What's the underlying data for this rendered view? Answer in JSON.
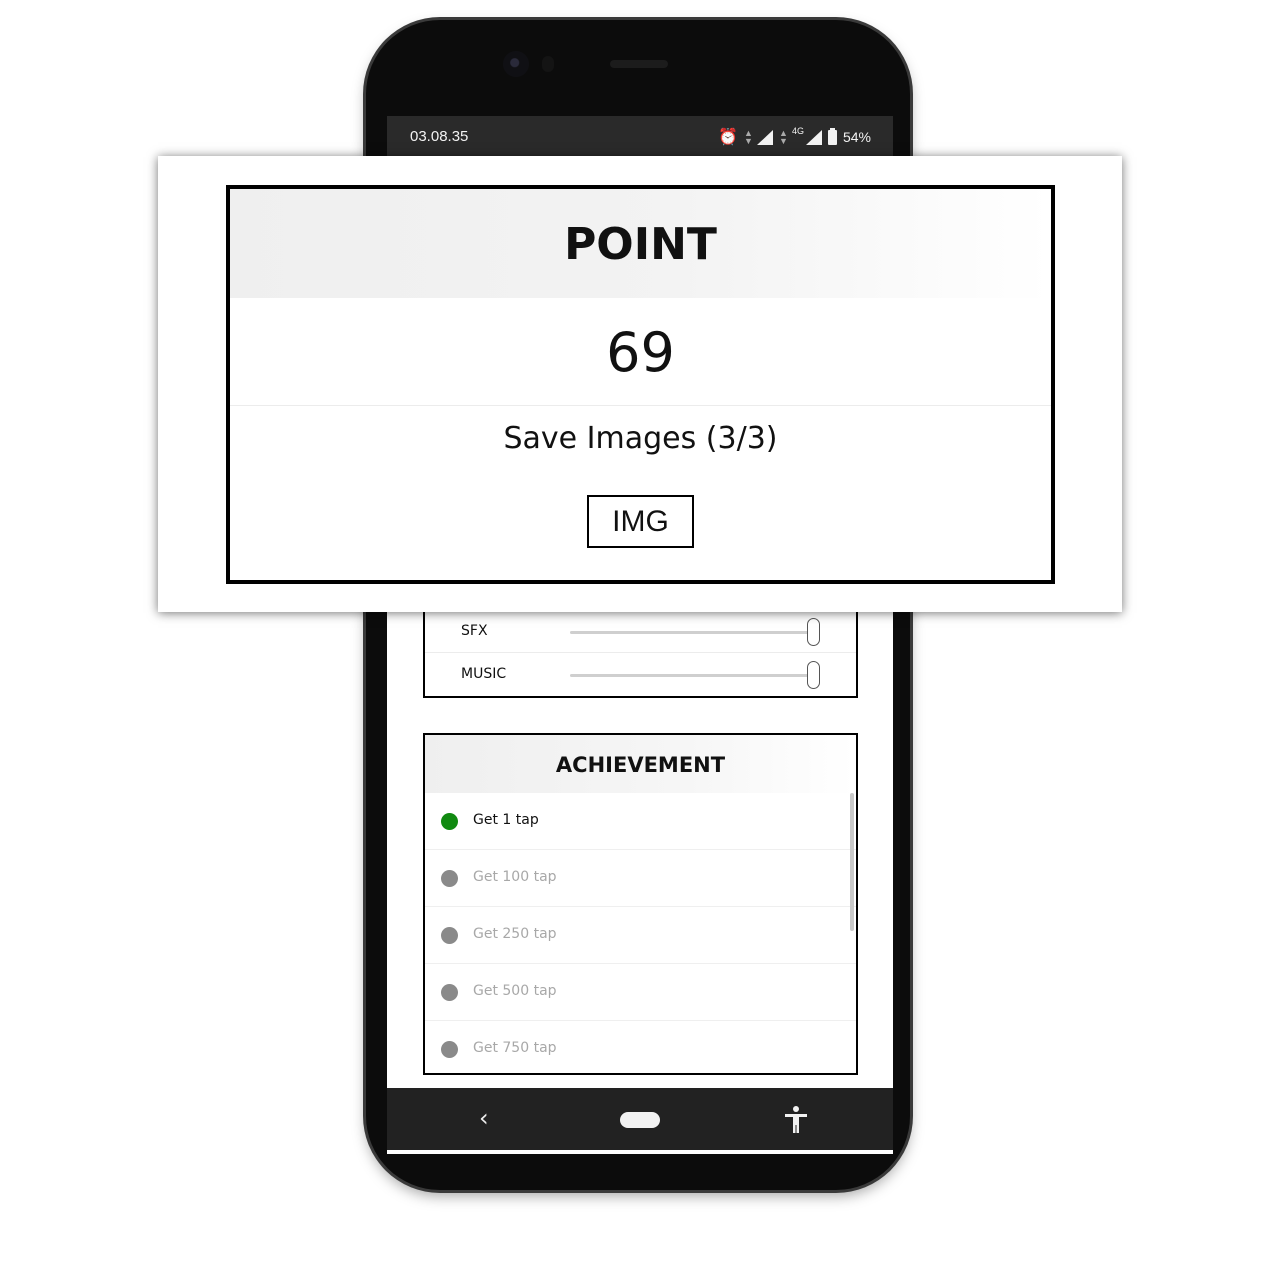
{
  "status_bar": {
    "time": "03.08.35",
    "network": "4G",
    "battery": "54%",
    "icons": [
      "alarm-icon",
      "signal-icon",
      "battery-icon"
    ]
  },
  "settings": {
    "rows": [
      {
        "label": "SFX",
        "level": 1.0
      },
      {
        "label": "MUSIC",
        "level": 1.0
      }
    ]
  },
  "achievement": {
    "title": "ACHIEVEMENT",
    "items": [
      {
        "label": "Get 1 tap",
        "unlocked": true
      },
      {
        "label": "Get 100 tap",
        "unlocked": false
      },
      {
        "label": "Get 250 tap",
        "unlocked": false
      },
      {
        "label": "Get 500 tap",
        "unlocked": false
      },
      {
        "label": "Get 750 tap",
        "unlocked": false
      }
    ],
    "colors": {
      "unlocked": "#118a11",
      "locked": "#8a8a8a"
    }
  },
  "navigation": {
    "back_icon": "chevron-left-icon",
    "home_icon": "home-pill-icon",
    "accessibility_icon": "accessibility-icon"
  },
  "popup": {
    "title": "POINT",
    "score": "69",
    "save_text": "Save Images (3/3)",
    "img_button": "IMG"
  }
}
